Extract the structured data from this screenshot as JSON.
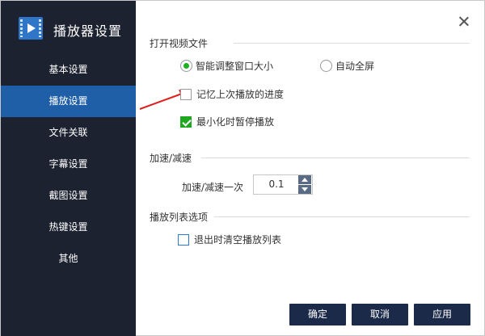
{
  "app": {
    "title": "播放器设置",
    "logo_icon": "video-player-icon"
  },
  "nav": {
    "items": [
      {
        "label": "基本设置",
        "active": false
      },
      {
        "label": "播放设置",
        "active": true
      },
      {
        "label": "文件关联",
        "active": false
      },
      {
        "label": "字幕设置",
        "active": false
      },
      {
        "label": "截图设置",
        "active": false
      },
      {
        "label": "热键设置",
        "active": false
      },
      {
        "label": "其他",
        "active": false
      }
    ],
    "active_color": "#1f5fa8",
    "background_color": "#1c2230"
  },
  "open_video": {
    "title": "打开视频文件",
    "radio_fit": {
      "label": "智能调整窗口大小",
      "checked": true
    },
    "radio_fullscreen": {
      "label": "自动全屏",
      "checked": false
    },
    "remember_progress": {
      "label": "记忆上次播放的进度",
      "checked": false
    },
    "minimize_pause": {
      "label": "最小化时暂停播放",
      "checked": true
    }
  },
  "speed": {
    "title": "加速/减速",
    "step_label": "加速/减速一次",
    "step_value": "0.1"
  },
  "playlist": {
    "title": "播放列表选项",
    "clear_on_exit": {
      "label": "退出时清空播放列表",
      "checked": false
    }
  },
  "buttons": {
    "ok": "确定",
    "cancel": "取消",
    "apply": "应用"
  },
  "colors": {
    "accent_green": "#1fb01f",
    "button_bg": "#1c2a4a",
    "annotation_arrow": "#e02020"
  }
}
